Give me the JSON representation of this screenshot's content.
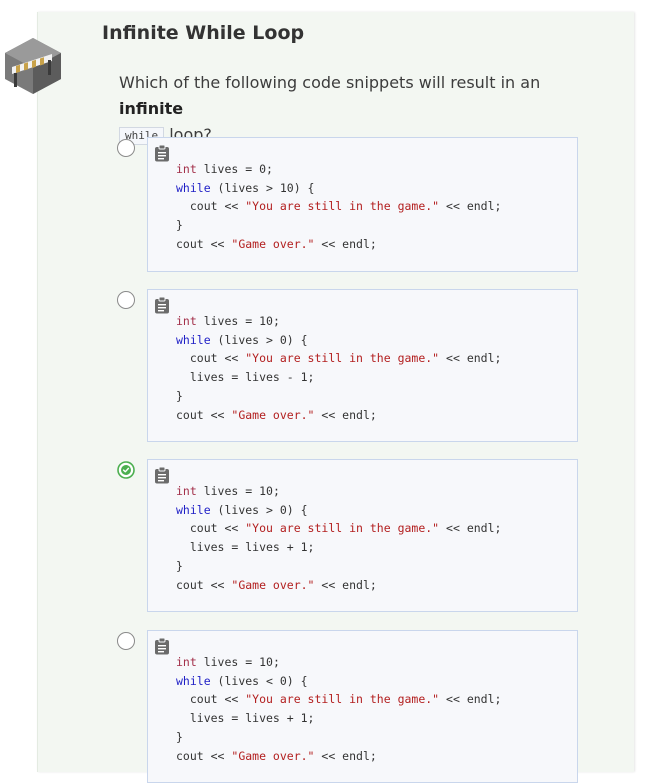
{
  "lesson": {
    "title": "Infinite While Loop",
    "question_before": "Which of the following code snippets will result in an ",
    "question_bold": "infinite",
    "question_code": "while",
    "question_after": " loop?"
  },
  "options": [
    {
      "selected": false,
      "lines": [
        [
          {
            "t": "type",
            "s": "int"
          },
          {
            "t": "plain",
            "s": " lives = 0;"
          }
        ],
        [
          {
            "t": "kw",
            "s": "while"
          },
          {
            "t": "plain",
            "s": " (lives > 10) {"
          }
        ],
        [
          {
            "t": "plain",
            "s": "  cout << "
          },
          {
            "t": "str",
            "s": "\"You are still in the game.\""
          },
          {
            "t": "plain",
            "s": " << endl;"
          }
        ],
        [
          {
            "t": "plain",
            "s": "}"
          }
        ],
        [
          {
            "t": "plain",
            "s": "cout << "
          },
          {
            "t": "str",
            "s": "\"Game over.\""
          },
          {
            "t": "plain",
            "s": " << endl;"
          }
        ]
      ]
    },
    {
      "selected": false,
      "lines": [
        [
          {
            "t": "type",
            "s": "int"
          },
          {
            "t": "plain",
            "s": " lives = 10;"
          }
        ],
        [
          {
            "t": "kw",
            "s": "while"
          },
          {
            "t": "plain",
            "s": " (lives > 0) {"
          }
        ],
        [
          {
            "t": "plain",
            "s": "  cout << "
          },
          {
            "t": "str",
            "s": "\"You are still in the game.\""
          },
          {
            "t": "plain",
            "s": " << endl;"
          }
        ],
        [
          {
            "t": "plain",
            "s": "  lives = lives - 1;"
          }
        ],
        [
          {
            "t": "plain",
            "s": "}"
          }
        ],
        [
          {
            "t": "plain",
            "s": "cout << "
          },
          {
            "t": "str",
            "s": "\"Game over.\""
          },
          {
            "t": "plain",
            "s": " << endl;"
          }
        ]
      ]
    },
    {
      "selected": true,
      "lines": [
        [
          {
            "t": "type",
            "s": "int"
          },
          {
            "t": "plain",
            "s": " lives = 10;"
          }
        ],
        [
          {
            "t": "kw",
            "s": "while"
          },
          {
            "t": "plain",
            "s": " (lives > 0) {"
          }
        ],
        [
          {
            "t": "plain",
            "s": "  cout << "
          },
          {
            "t": "str",
            "s": "\"You are still in the game.\""
          },
          {
            "t": "plain",
            "s": " << endl;"
          }
        ],
        [
          {
            "t": "plain",
            "s": "  lives = lives + 1;"
          }
        ],
        [
          {
            "t": "plain",
            "s": "}"
          }
        ],
        [
          {
            "t": "plain",
            "s": "cout << "
          },
          {
            "t": "str",
            "s": "\"Game over.\""
          },
          {
            "t": "plain",
            "s": " << endl;"
          }
        ]
      ]
    },
    {
      "selected": false,
      "lines": [
        [
          {
            "t": "type",
            "s": "int"
          },
          {
            "t": "plain",
            "s": " lives = 10;"
          }
        ],
        [
          {
            "t": "kw",
            "s": "while"
          },
          {
            "t": "plain",
            "s": " (lives < 0) {"
          }
        ],
        [
          {
            "t": "plain",
            "s": "  cout << "
          },
          {
            "t": "str",
            "s": "\"You are still in the game.\""
          },
          {
            "t": "plain",
            "s": " << endl;"
          }
        ],
        [
          {
            "t": "plain",
            "s": "  lives = lives + 1;"
          }
        ],
        [
          {
            "t": "plain",
            "s": "}"
          }
        ],
        [
          {
            "t": "plain",
            "s": "cout << "
          },
          {
            "t": "str",
            "s": "\"Game over.\""
          },
          {
            "t": "plain",
            "s": " << endl;"
          }
        ]
      ]
    }
  ],
  "icons": {
    "badge": "hurdle-icon",
    "copy": "clipboard-icon",
    "correct": "check-circle-icon"
  },
  "colors": {
    "card_bg": "#f3f7f2",
    "correct": "#4caf50",
    "keyword": "#1f1fc6",
    "string": "#b32020",
    "type": "#a3304a",
    "code_border": "#c9d6ec"
  }
}
